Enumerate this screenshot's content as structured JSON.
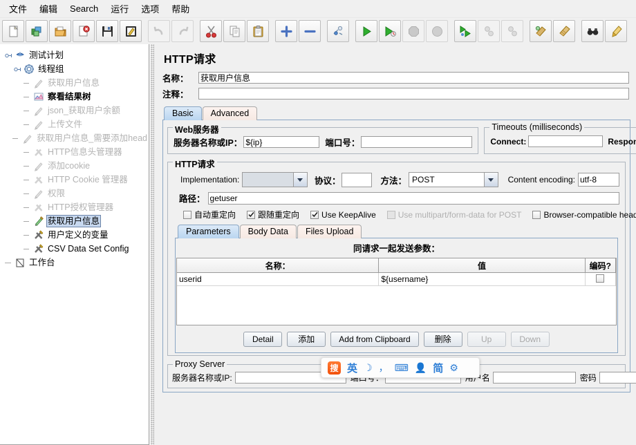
{
  "menu": {
    "items": [
      {
        "label": "文件",
        "name": "menu-file"
      },
      {
        "label": "编辑",
        "name": "menu-edit"
      },
      {
        "label": "Search",
        "name": "menu-search"
      },
      {
        "label": "运行",
        "name": "menu-run"
      },
      {
        "label": "选项",
        "name": "menu-options"
      },
      {
        "label": "帮助",
        "name": "menu-help"
      }
    ]
  },
  "toolbar": {
    "buttons": [
      {
        "icon": "new-file-icon",
        "name": "new-button",
        "enabled": true
      },
      {
        "icon": "templates-icon",
        "name": "templates-button",
        "enabled": true
      },
      {
        "icon": "open-folder-icon",
        "name": "open-button",
        "enabled": true
      },
      {
        "icon": "close-file-icon",
        "name": "close-button",
        "enabled": true
      },
      {
        "icon": "save-icon",
        "name": "save-button",
        "enabled": true
      },
      {
        "icon": "save-as-icon",
        "name": "save-as-button",
        "enabled": true
      },
      {
        "icon": "undo-icon",
        "name": "undo-button",
        "enabled": false
      },
      {
        "icon": "redo-icon",
        "name": "redo-button",
        "enabled": false
      },
      {
        "icon": "cut-scissors-icon",
        "name": "cut-button",
        "enabled": true
      },
      {
        "icon": "copy-icon",
        "name": "copy-button",
        "enabled": true
      },
      {
        "icon": "paste-clipboard-icon",
        "name": "paste-button",
        "enabled": true
      },
      {
        "icon": "expand-plus-icon",
        "name": "expand-all-button",
        "enabled": true
      },
      {
        "icon": "collapse-minus-icon",
        "name": "collapse-all-button",
        "enabled": true
      },
      {
        "icon": "toggle-icon",
        "name": "toggle-button",
        "enabled": true
      },
      {
        "icon": "start-play-icon",
        "name": "start-button",
        "enabled": true
      },
      {
        "icon": "start-no-timers-icon",
        "name": "start-no-pauses-button",
        "enabled": true
      },
      {
        "icon": "stop-icon",
        "name": "stop-button",
        "enabled": false
      },
      {
        "icon": "shutdown-icon",
        "name": "shutdown-button",
        "enabled": false
      },
      {
        "icon": "remote-start-icon",
        "name": "remote-start-all-button",
        "enabled": true
      },
      {
        "icon": "remote-stop-icon",
        "name": "remote-stop-all-button",
        "enabled": false
      },
      {
        "icon": "remote-shutdown-icon",
        "name": "remote-shutdown-all-button",
        "enabled": false
      },
      {
        "icon": "clear-broom-icon",
        "name": "clear-button",
        "enabled": true
      },
      {
        "icon": "clear-all-broom-icon",
        "name": "clear-all-button",
        "enabled": true
      },
      {
        "icon": "search-binoculars-icon",
        "name": "search-button",
        "enabled": true
      },
      {
        "icon": "reset-search-icon",
        "name": "reset-search-button",
        "enabled": true
      }
    ]
  },
  "tree": {
    "nodes": [
      {
        "label": "测试计划",
        "icon": "test-plan-icon",
        "depth": 0,
        "state": "normal",
        "name": "tree-node-test-plan"
      },
      {
        "label": "线程组",
        "icon": "thread-group-icon",
        "depth": 1,
        "state": "normal",
        "name": "tree-node-thread-group"
      },
      {
        "label": "获取用户信息",
        "icon": "http-sampler-icon",
        "depth": 2,
        "state": "disabled",
        "name": "tree-node-get-user-info-1"
      },
      {
        "label": "察看结果树",
        "icon": "view-results-tree-icon",
        "depth": 2,
        "state": "bold",
        "name": "tree-node-view-results-tree"
      },
      {
        "label": "json_获取用户余额",
        "icon": "http-sampler-icon",
        "depth": 2,
        "state": "disabled",
        "name": "tree-node-json-get-balance"
      },
      {
        "label": "上传文件",
        "icon": "http-sampler-icon",
        "depth": 2,
        "state": "disabled",
        "name": "tree-node-upload-file"
      },
      {
        "label": "获取用户信息_需要添加head",
        "icon": "http-sampler-icon",
        "depth": 2,
        "state": "disabled",
        "name": "tree-node-get-user-info-header"
      },
      {
        "label": "HTTP信息头管理器",
        "icon": "config-element-icon",
        "depth": 2,
        "state": "disabled",
        "name": "tree-node-http-header-manager"
      },
      {
        "label": "添加cookie",
        "icon": "http-sampler-icon",
        "depth": 2,
        "state": "disabled",
        "name": "tree-node-add-cookie"
      },
      {
        "label": "HTTP Cookie 管理器",
        "icon": "config-element-icon",
        "depth": 2,
        "state": "disabled",
        "name": "tree-node-http-cookie-manager"
      },
      {
        "label": "权限",
        "icon": "http-sampler-icon",
        "depth": 2,
        "state": "disabled",
        "name": "tree-node-auth"
      },
      {
        "label": "HTTP授权管理器",
        "icon": "config-element-icon",
        "depth": 2,
        "state": "disabled",
        "name": "tree-node-http-auth-manager"
      },
      {
        "label": "获取用户信息",
        "icon": "http-sampler-icon",
        "depth": 2,
        "state": "selected",
        "name": "tree-node-get-user-info-selected"
      },
      {
        "label": "用户定义的变量",
        "icon": "config-element-icon",
        "depth": 2,
        "state": "normal",
        "name": "tree-node-user-defined-variables"
      },
      {
        "label": "CSV Data Set Config",
        "icon": "config-element-icon",
        "depth": 2,
        "state": "normal",
        "name": "tree-node-csv-data-set-config"
      },
      {
        "label": "工作台",
        "icon": "workbench-icon",
        "depth": 0,
        "state": "normal",
        "name": "tree-node-workbench"
      }
    ]
  },
  "editor": {
    "title": "HTTP请求",
    "name_label": "名称：",
    "name_value": "获取用户信息",
    "comment_label": "注释：",
    "comment_value": "",
    "tabs": [
      {
        "label": "Basic",
        "active": true,
        "name": "tab-basic"
      },
      {
        "label": "Advanced",
        "active": false,
        "name": "tab-advanced"
      }
    ],
    "web_server": {
      "title": "Web服务器",
      "server_label": "服务器名称或IP：",
      "server_value": "${ip}",
      "port_label": "端口号：",
      "port_value": ""
    },
    "timeouts": {
      "title": "Timeouts (milliseconds)",
      "connect_label": "Connect:",
      "connect_value": "",
      "response_label": "Response:",
      "response_value": ""
    },
    "http_request": {
      "title": "HTTP请求",
      "implementation_label": "Implementation:",
      "implementation_value": "",
      "protocol_label": "协议：",
      "protocol_value": "",
      "method_label": "方法：",
      "method_value": "POST",
      "content_encoding_label": "Content encoding:",
      "content_encoding_value": "utf-8",
      "path_label": "路径：",
      "path_value": "getuser"
    },
    "checkboxes": [
      {
        "label": "自动重定向",
        "checked": false,
        "enabled": true,
        "name": "checkbox-auto-redirect"
      },
      {
        "label": "跟随重定向",
        "checked": true,
        "enabled": true,
        "name": "checkbox-follow-redirects"
      },
      {
        "label": "Use KeepAlive",
        "checked": true,
        "enabled": true,
        "name": "checkbox-use-keepalive"
      },
      {
        "label": "Use multipart/form-data for POST",
        "checked": false,
        "enabled": false,
        "name": "checkbox-use-multipart"
      },
      {
        "label": "Browser-compatible headers",
        "checked": false,
        "enabled": true,
        "name": "checkbox-browser-compatible-headers"
      }
    ],
    "param_tabs": [
      {
        "label": "Parameters",
        "active": true,
        "name": "tab-parameters"
      },
      {
        "label": "Body Data",
        "active": false,
        "name": "tab-body-data"
      },
      {
        "label": "Files Upload",
        "active": false,
        "name": "tab-files-upload"
      }
    ],
    "params_table": {
      "caption": "同请求一起发送参数：",
      "columns": [
        "名称：",
        "值",
        "编码?"
      ],
      "rows": [
        {
          "name": "userid",
          "value": "${username}",
          "encode": false
        }
      ]
    },
    "table_buttons": [
      {
        "label": "Detail",
        "enabled": true,
        "name": "detail-button"
      },
      {
        "label": "添加",
        "enabled": true,
        "name": "add-button"
      },
      {
        "label": "Add from Clipboard",
        "enabled": true,
        "name": "add-from-clipboard-button"
      },
      {
        "label": "删除",
        "enabled": true,
        "name": "delete-button"
      },
      {
        "label": "Up",
        "enabled": false,
        "name": "up-button"
      },
      {
        "label": "Down",
        "enabled": false,
        "name": "down-button"
      }
    ],
    "proxy_server": {
      "title": "Proxy Server",
      "server_label": "服务器名称或IP:",
      "server_value": "",
      "port_label": "端口号：",
      "port_value": "",
      "username_label": "用户名",
      "username_value": "",
      "password_label": "密码",
      "password_value": ""
    }
  },
  "ime": {
    "logo": "搜",
    "mode": "英",
    "moon": "☽",
    "punct": "，",
    "keyboard": "⌨",
    "user": "👤",
    "simplified": "简",
    "gear": "⚙"
  }
}
